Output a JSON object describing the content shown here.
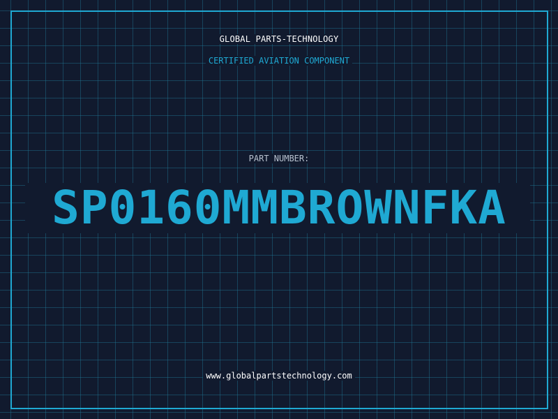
{
  "company_name": "GLOBAL PARTS-TECHNOLOGY",
  "subtitle": "CERTIFIED AVIATION COMPONENT",
  "part_label": "PART NUMBER:",
  "part_number": "SP0160MMBROWNFKA",
  "website": "www.globalpartstechnology.com",
  "colors": {
    "background": "#111a2e",
    "accent": "#1fa9d3",
    "grid": "#207896",
    "text_primary": "#ffffff",
    "text_muted": "#b8c2cf"
  }
}
